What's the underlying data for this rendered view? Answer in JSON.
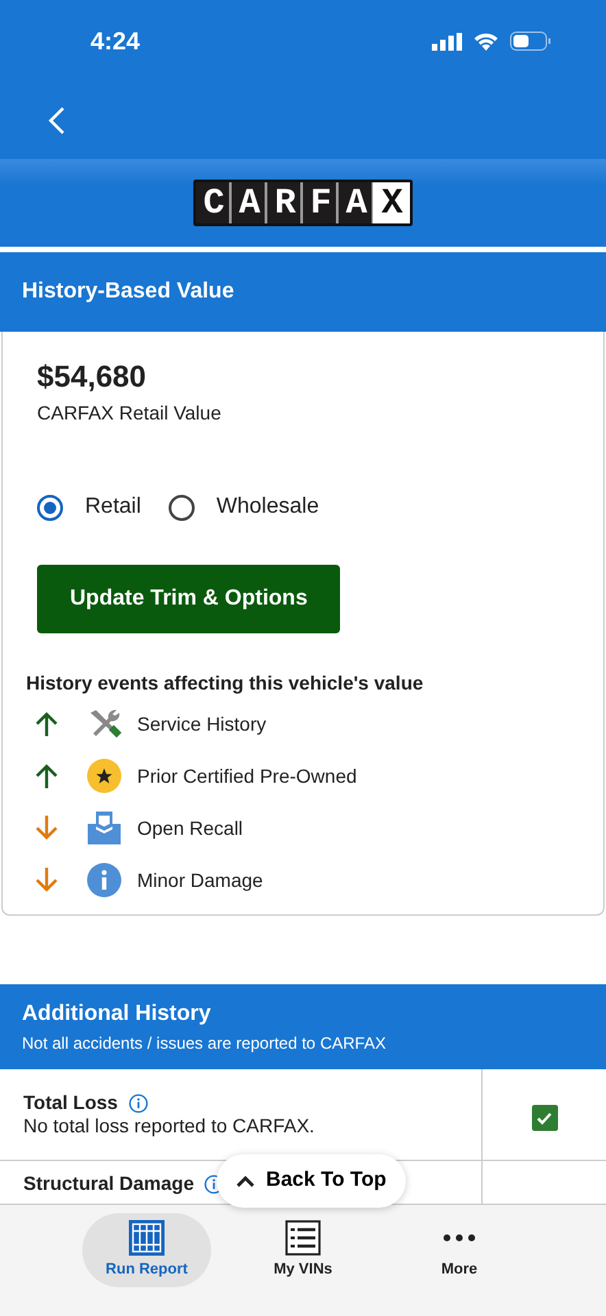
{
  "status_bar": {
    "time": "4:24"
  },
  "logo": {
    "letters": "CARFAX"
  },
  "section_title": "History-Based Value",
  "value": {
    "price": "$54,680",
    "label": "CARFAX Retail Value"
  },
  "value_types": [
    {
      "label": "Retail",
      "selected": true
    },
    {
      "label": "Wholesale",
      "selected": false
    }
  ],
  "update_button": "Update Trim & Options",
  "events_heading": "History events affecting this vehicle's value",
  "events": [
    {
      "label": "Service History",
      "increases_value": true,
      "kind": "service"
    },
    {
      "label": "Prior Certified Pre-Owned",
      "increases_value": true,
      "kind": "certified"
    },
    {
      "label": "Open Recall",
      "increases_value": false,
      "kind": "recall"
    },
    {
      "label": "Minor Damage",
      "increases_value": false,
      "kind": "damage"
    }
  ],
  "additional": {
    "title": "Additional History",
    "subtitle": "Not all accidents / issues are reported to CARFAX"
  },
  "history_rows": [
    {
      "title": "Total Loss",
      "detail": "No total loss reported to CARFAX.",
      "checked": true
    },
    {
      "title": "Structural Damage"
    }
  ],
  "back_to_top": "Back To Top",
  "tabs": [
    {
      "label": "Run Report",
      "kind": "report",
      "selected": true
    },
    {
      "label": "My VINs",
      "kind": "vins",
      "selected": false
    },
    {
      "label": "More",
      "kind": "more",
      "selected": false
    }
  ]
}
